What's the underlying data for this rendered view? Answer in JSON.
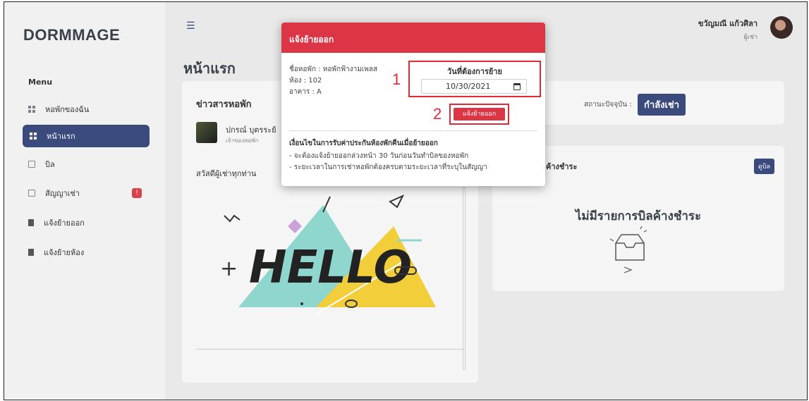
{
  "app": {
    "brand": "DORMMAGE"
  },
  "sidebar": {
    "menu_label": "Menu",
    "items": [
      {
        "label": "หอพักของฉัน",
        "icon": "grid-icon"
      },
      {
        "label": "หน้าแรก",
        "icon": "grid-icon",
        "active": true
      },
      {
        "label": "บิล",
        "icon": "document-icon"
      },
      {
        "label": "สัญญาเช่า",
        "icon": "document-icon",
        "badge": "!"
      },
      {
        "label": "แจ้งย้ายออก",
        "icon": "book-icon"
      },
      {
        "label": "แจ้งย้ายห้อง",
        "icon": "book-icon"
      }
    ]
  },
  "header": {
    "user_name": "ขวัญมณี แก้วศิลา",
    "user_role": "ผู้เช่า",
    "page_title": "หน้าแรก"
  },
  "news": {
    "title": "ข่าวสารหอพัก",
    "author": "ปกรณ์ บุตรระย้",
    "author_role": "เจ้าของหอพัก",
    "greeting": "สวัสดีผู้เช่าทุกท่าน",
    "image_text": "HELLO"
  },
  "status": {
    "label": "สถานะปัจจุบัน :",
    "value": "กำลังเช่า"
  },
  "bill": {
    "title": "ค้างชำระ",
    "button": "ดูบิล",
    "empty": "ไม่มีรายการบิลค้างชำระ"
  },
  "modal": {
    "title": "แจ้งย้ายออก",
    "dorm_name": "ชื่อหอพัก : หอพักฟ้างามเพลส",
    "room": "ห้อง : 102",
    "building": "อาคาร : A",
    "move_date_label": "วันที่ต้องการย้าย",
    "move_date_value": "10/30/2021",
    "annotation_1": "1",
    "annotation_2": "2",
    "submit": "แจ้งย้ายออก",
    "conditions_title": "เงื่อนไขในการรับค่าประกันห้องพักคืนเมื่อย้ายออก",
    "conditions": [
      "- จะต้องแจ้งย้ายออกล่วงหน้า 30 วันก่อนวันทำบิลของหอพัก",
      "- ระยะเวลาในการเช่าหอพักต้องครบตามระยะเวลาที่ระบุในสัญญา"
    ]
  },
  "colors": {
    "accent": "#3b4a7d",
    "danger": "#dc3545",
    "annotation": "#e02b36"
  }
}
